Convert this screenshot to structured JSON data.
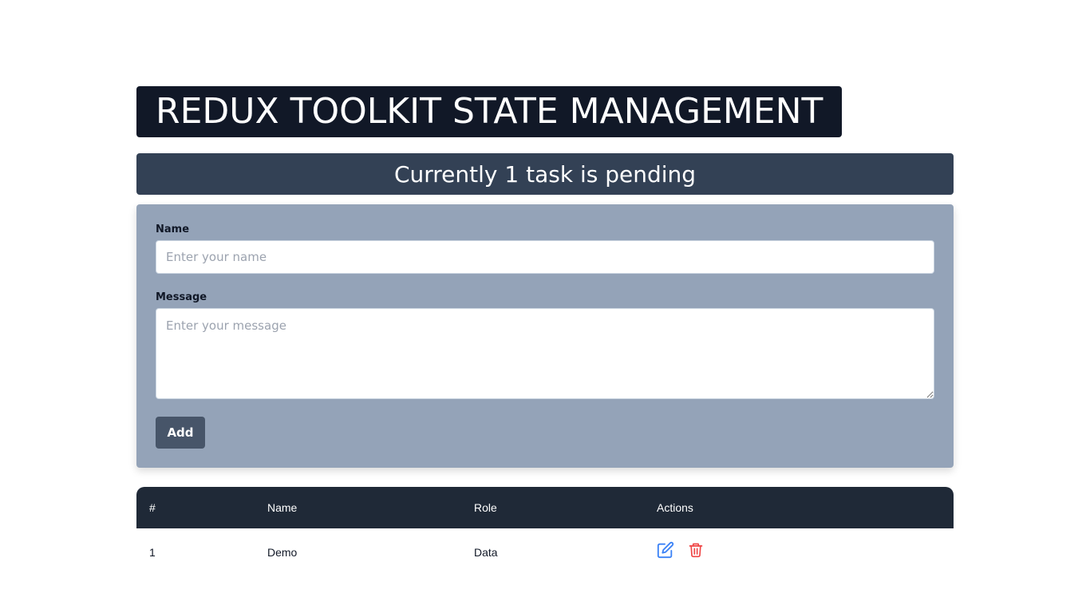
{
  "header": {
    "title": "REDUX TOOLKIT STATE MANAGEMENT",
    "status": "Currently 1 task is pending"
  },
  "form": {
    "name_label": "Name",
    "name_placeholder": "Enter your name",
    "name_value": "",
    "message_label": "Message",
    "message_placeholder": "Enter your message",
    "message_value": "",
    "add_label": "Add"
  },
  "table": {
    "columns": [
      "#",
      "Name",
      "Role",
      "Actions"
    ],
    "rows": [
      {
        "id": "1",
        "name": "Demo",
        "role": "Data",
        "actions": [
          "edit-icon",
          "trash-icon"
        ]
      }
    ]
  },
  "colors": {
    "title_bg": "#111827",
    "status_bg": "#334155",
    "form_bg": "#94a3b8",
    "button_bg": "#475569",
    "table_header_bg": "#1f2937",
    "edit_icon": "#3b82f6",
    "delete_icon": "#ef4444"
  }
}
